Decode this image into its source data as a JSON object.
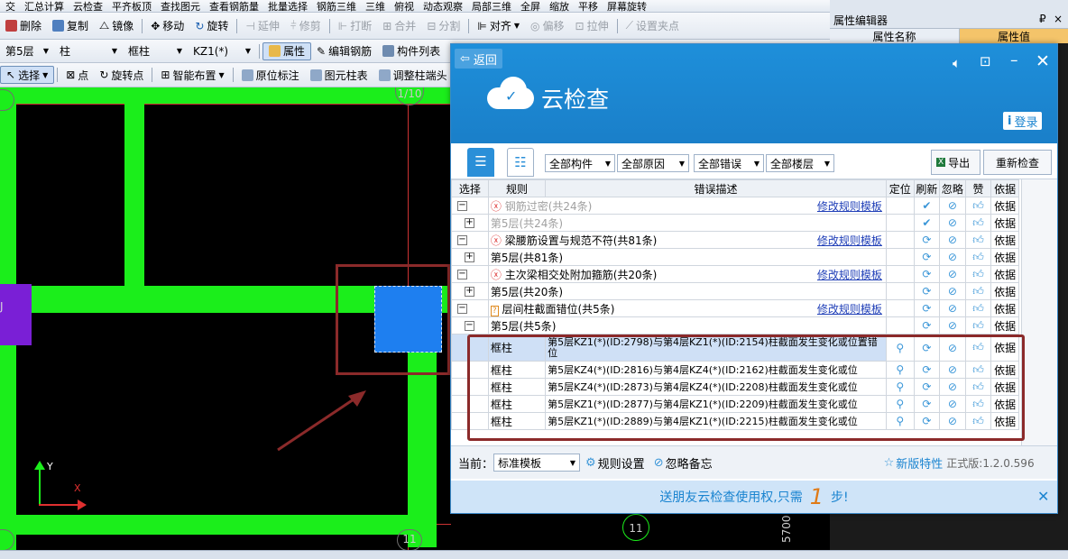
{
  "colors": {
    "accent": "#1a84d0",
    "canvas": "#000000",
    "wall": "#1bee1b",
    "highlight_box": "#8b2a2a",
    "column_blue": "#1e7ff0",
    "column_purple": "#7a1fd6"
  },
  "toolbar_top": {
    "items": [
      "交",
      "汇总计算",
      "云检查",
      "平齐板顶",
      "查找图元",
      "查看钢筋量",
      "批量选择",
      "钢筋三维",
      "三维",
      "俯视",
      "动态观察",
      "局部三维",
      "全屏",
      "缩放",
      "平移",
      "屏幕旋转"
    ]
  },
  "toolbar1": {
    "items": [
      "删除",
      "复制",
      "镜像",
      "移动",
      "旋转",
      "延伸",
      "修剪",
      "打断",
      "合并",
      "分割",
      "对齐",
      "偏移",
      "拉伸",
      "设置夹点"
    ]
  },
  "toolbar2": {
    "floor": "第5层",
    "type": "柱",
    "subtype": "框柱",
    "name": "KZ1(*)",
    "items": [
      "属性",
      "编辑钢筋",
      "构件列表"
    ]
  },
  "toolbar3": {
    "items": [
      "选择",
      "点",
      "旋转点",
      "智能布置",
      "原位标注",
      "图元柱表",
      "调整柱端头"
    ]
  },
  "canvas": {
    "axis_top": "1/10",
    "axis_bottom": "11",
    "axis_left": "J",
    "axis_y": "Y",
    "axis_x": "X",
    "dim_text": "5700"
  },
  "prop_panel": {
    "title": "属性编辑器",
    "col_name": "属性名称",
    "col_value": "属性值",
    "pin": "₽",
    "close": "×"
  },
  "dialog": {
    "back_label": "返回",
    "title": "云检查",
    "login_label": "登录",
    "export_label": "导出",
    "recheck_label": "重新检查",
    "filters": [
      "全部构件",
      "全部原因",
      "全部错误",
      "全部楼层"
    ],
    "headers": [
      "选择",
      "规则",
      "错误描述",
      "定位",
      "刷新",
      "忽略",
      "赞",
      "依据"
    ],
    "modify_link": "修改规则模板",
    "basis": "依据",
    "groups": [
      {
        "title": "钢筋过密(共24条)",
        "sub": "第5层(共24条)",
        "gray": true
      },
      {
        "title": "梁腰筋设置与规范不符(共81条)",
        "sub": "第5层(共81条)",
        "gray": false
      },
      {
        "title": "主次梁相交处附加箍筋(共20条)",
        "sub": "第5层(共20条)",
        "gray": false
      },
      {
        "title": "层间柱截面错位(共5条)",
        "sub": "第5层(共5条)",
        "gray": false,
        "warn": true
      }
    ],
    "rows": [
      {
        "type": "框柱",
        "desc": "第5层KZ1(*)(ID:2798)与第4层KZ1(*)(ID:2154)柱截面发生变化或位置错位"
      },
      {
        "type": "框柱",
        "desc": "第5层KZ4(*)(ID:2816)与第4层KZ4(*)(ID:2162)柱截面发生变化或位"
      },
      {
        "type": "框柱",
        "desc": "第5层KZ4(*)(ID:2873)与第4层KZ4(*)(ID:2208)柱截面发生变化或位"
      },
      {
        "type": "框柱",
        "desc": "第5层KZ1(*)(ID:2877)与第4层KZ1(*)(ID:2209)柱截面发生变化或位"
      },
      {
        "type": "框柱",
        "desc": "第5层KZ1(*)(ID:2889)与第4层KZ1(*)(ID:2215)柱截面发生变化或位"
      }
    ],
    "current_label": "当前：",
    "template_value": "标准模板",
    "rules_label": "规则设置",
    "ignore_note": "忽略备忘",
    "new_feature": "新版特性",
    "version": "正式版:1.2.0.596",
    "banner_a": "送朋友云检查使用权,只需",
    "banner_num": "1",
    "banner_b": "步!"
  }
}
